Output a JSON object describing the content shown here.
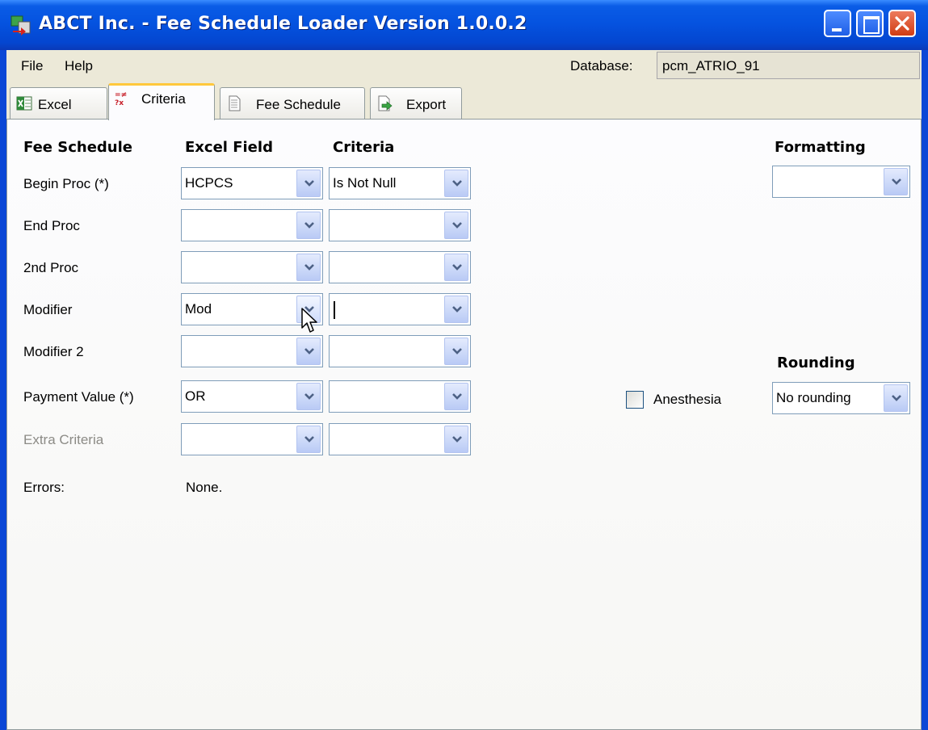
{
  "window": {
    "title": "ABCT Inc. - Fee Schedule Loader Version 1.0.0.2"
  },
  "menu": {
    "file": "File",
    "help": "Help"
  },
  "database": {
    "label": "Database:",
    "value": "pcm_ATRIO_91"
  },
  "tabs": [
    {
      "label": "Excel",
      "icon": "excel-icon"
    },
    {
      "label": "Criteria",
      "icon": "criteria-icon",
      "active": true
    },
    {
      "label": "Fee Schedule",
      "icon": "document-icon"
    },
    {
      "label": "Export",
      "icon": "export-icon"
    }
  ],
  "headers": {
    "fee_schedule": "Fee Schedule",
    "excel_field": "Excel Field",
    "criteria": "Criteria",
    "formatting": "Formatting",
    "rounding": "Rounding"
  },
  "rows": [
    {
      "label": "Begin Proc (*)",
      "excel_field": "HCPCS",
      "criteria": "Is Not Null"
    },
    {
      "label": "End Proc",
      "excel_field": "",
      "criteria": ""
    },
    {
      "label": "2nd Proc",
      "excel_field": "",
      "criteria": ""
    },
    {
      "label": "Modifier",
      "excel_field": "Mod",
      "criteria": ""
    },
    {
      "label": "Modifier 2",
      "excel_field": "",
      "criteria": ""
    },
    {
      "label": "Payment Value (*)",
      "excel_field": "OR",
      "criteria": ""
    },
    {
      "label": "Extra Criteria",
      "excel_field": "",
      "criteria": ""
    }
  ],
  "errors": {
    "label": "Errors:",
    "value": "None."
  },
  "formatting": {
    "value": ""
  },
  "rounding": {
    "value": "No rounding"
  },
  "anesthesia": {
    "label": "Anesthesia",
    "checked": false
  }
}
